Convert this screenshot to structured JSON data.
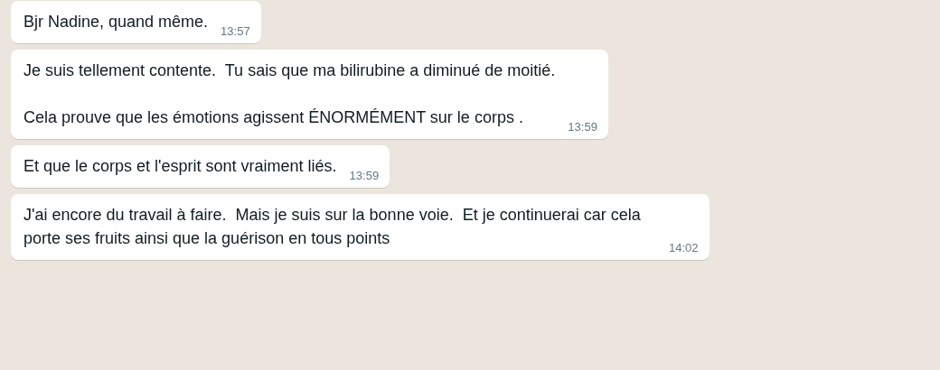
{
  "messages": [
    {
      "text": "Bjr Nadine, quand même.",
      "time": "13:57"
    },
    {
      "text": "Je suis tellement contente.  Tu sais que ma bilirubine a diminué de moitié.\n\nCela prouve que les émotions agissent ÉNORMÉMENT sur le corps .",
      "time": "13:59"
    },
    {
      "text": "Et que le corps et l'esprit sont vraiment liés.",
      "time": "13:59"
    },
    {
      "text": "J'ai encore du travail à faire.  Mais je suis sur la bonne voie.  Et je continuerai car cela porte ses fruits ainsi que la guérison en tous points",
      "time": "14:02"
    }
  ]
}
